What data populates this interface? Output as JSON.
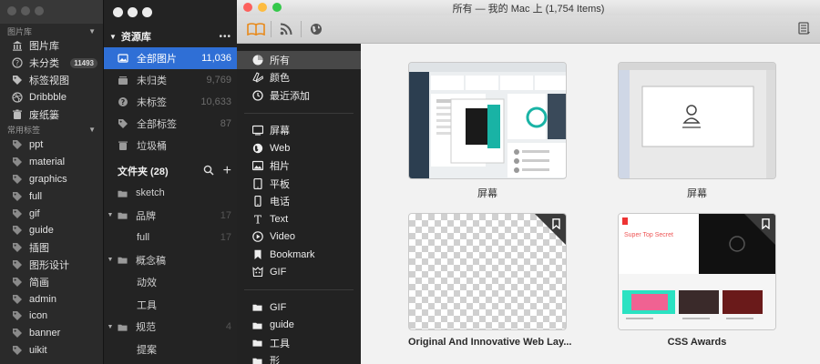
{
  "w1": {
    "sections": [
      {
        "label": "图片库",
        "items": [
          {
            "label": "图片库",
            "icon": "museum-icon"
          },
          {
            "label": "未分类",
            "icon": "question-icon",
            "count": "11493"
          },
          {
            "label": "标签视图",
            "icon": "tag-icon"
          },
          {
            "label": "Dribbble",
            "icon": "dribbble-icon"
          },
          {
            "label": "废纸篓",
            "icon": "trash-icon"
          }
        ]
      },
      {
        "label": "常用标签",
        "items": [
          {
            "label": "ppt"
          },
          {
            "label": "material"
          },
          {
            "label": "graphics"
          },
          {
            "label": "full"
          },
          {
            "label": "gif"
          },
          {
            "label": "guide"
          },
          {
            "label": "插图"
          },
          {
            "label": "图形设计"
          },
          {
            "label": "简画"
          },
          {
            "label": "admin"
          },
          {
            "label": "icon"
          },
          {
            "label": "banner"
          },
          {
            "label": "uikit"
          }
        ]
      }
    ]
  },
  "w2": {
    "library_header": "资源库",
    "library_more": "•••",
    "library": [
      {
        "label": "全部图片",
        "count": "11,036",
        "selected": true
      },
      {
        "label": "未归类",
        "count": "9,769"
      },
      {
        "label": "未标签",
        "count": "10,633"
      },
      {
        "label": "全部标签",
        "count": "87"
      },
      {
        "label": "垃圾桶",
        "count": ""
      }
    ],
    "folders_header": "文件夹 (28)",
    "folders": [
      {
        "label": "sketch",
        "count": "",
        "expandable": false,
        "indent": 0
      },
      {
        "label": "品牌",
        "count": "17",
        "expandable": true,
        "indent": 0
      },
      {
        "label": "full",
        "count": "17",
        "expandable": false,
        "indent": 1
      },
      {
        "label": "概念稿",
        "count": "",
        "expandable": true,
        "indent": 0
      },
      {
        "label": "动效",
        "count": "",
        "expandable": false,
        "indent": 1
      },
      {
        "label": "工具",
        "count": "",
        "expandable": false,
        "indent": 1
      },
      {
        "label": "规范",
        "count": "4",
        "expandable": true,
        "indent": 0
      },
      {
        "label": "提案",
        "count": "",
        "expandable": false,
        "indent": 1
      }
    ]
  },
  "w3": {
    "title": "所有 — 我的 Mac 上 (1,754 Items)",
    "side_groups": [
      [
        {
          "label": "所有",
          "icon": "all-icon",
          "selected": true
        },
        {
          "label": "颜色",
          "icon": "palette-icon"
        },
        {
          "label": "最近添加",
          "icon": "clock-icon"
        }
      ],
      [
        {
          "label": "屏幕",
          "icon": "screen-icon"
        },
        {
          "label": "Web",
          "icon": "globe-icon"
        },
        {
          "label": "相片",
          "icon": "photo-icon"
        },
        {
          "label": "平板",
          "icon": "tablet-icon"
        },
        {
          "label": "电话",
          "icon": "phone-icon"
        },
        {
          "label": "Text",
          "icon": "text-icon"
        },
        {
          "label": "Video",
          "icon": "video-icon"
        },
        {
          "label": "Bookmark",
          "icon": "bookmark-icon"
        },
        {
          "label": "GIF",
          "icon": "gif-icon"
        }
      ],
      [
        {
          "label": "GIF",
          "icon": "folder-icon"
        },
        {
          "label": "guide",
          "icon": "folder-icon"
        },
        {
          "label": "工具",
          "icon": "folder-icon"
        },
        {
          "label": "形",
          "icon": "folder-icon"
        }
      ]
    ],
    "cards": [
      {
        "caption": "屏幕",
        "type": "dashboard"
      },
      {
        "caption": "屏幕",
        "type": "editor"
      },
      {
        "caption": "Original And Innovative Web Lay...",
        "type": "transparent"
      },
      {
        "caption": "CSS Awards",
        "type": "cssawards",
        "thumb_title": "Super Top Secret"
      }
    ]
  },
  "colors": {
    "selection": "#2f6fd6",
    "accent_orange": "#e8891a"
  }
}
